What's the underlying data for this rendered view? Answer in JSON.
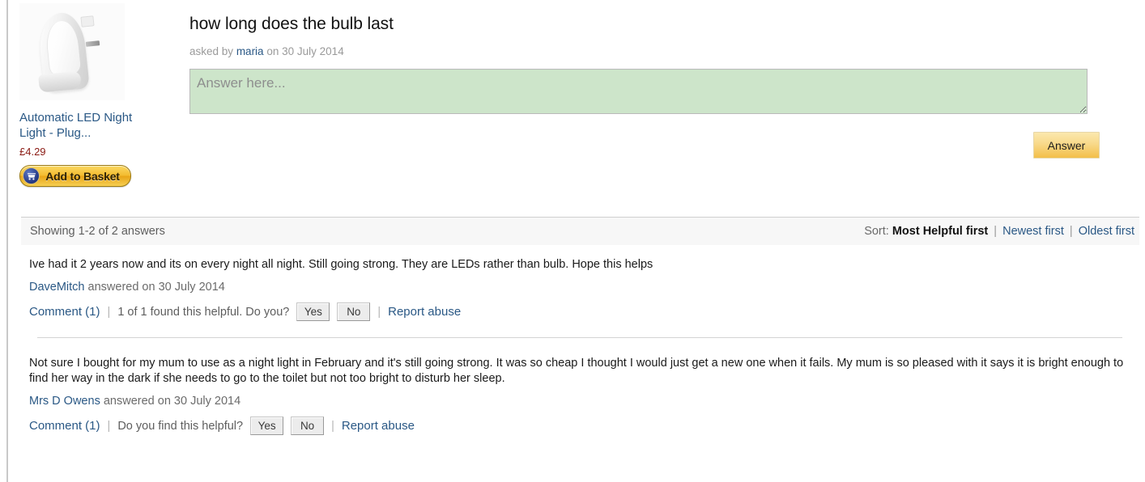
{
  "product": {
    "image_alt": "Automatic LED Night Light plug-in",
    "title": "Automatic LED Night Light - Plug...",
    "price": "£4.29",
    "add_to_basket_label": "Add to Basket"
  },
  "question": {
    "title": "how long does the bulb last",
    "asked_by_prefix": "asked by",
    "author": "maria",
    "date_prefix": "on",
    "date": "30 July 2014"
  },
  "answer_form": {
    "placeholder": "Answer here...",
    "submit_label": "Answer"
  },
  "list_header": {
    "showing": "Showing 1-2 of 2 answers",
    "sort_label": "Sort:",
    "sort_active": "Most Helpful first",
    "sort_options": [
      "Newest first",
      "Oldest first"
    ],
    "separator": "|"
  },
  "answers": [
    {
      "text": "Ive had it 2 years now and its on every night all night. Still going strong. They are LEDs rather than bulb. Hope this helps",
      "author": "DaveMitch",
      "answered_prefix": "answered on",
      "date": "30 July 2014",
      "comment_label": "Comment (1)",
      "helpful_text": "1 of 1 found this helpful. Do you?",
      "yes_label": "Yes",
      "no_label": "No",
      "report_label": "Report abuse"
    },
    {
      "text": "Not sure I bought for my mum to use as a night light in February and it's still going strong. It was so cheap I thought I would just get a new one when it fails. My mum is so pleased with it says it is bright enough to find her way in the dark if she needs to go to the toilet but not too bright to disturb her sleep.",
      "author": "Mrs D Owens",
      "answered_prefix": "answered on",
      "date": "30 July 2014",
      "comment_label": "Comment (1)",
      "helpful_text": "Do you find this helpful?",
      "yes_label": "Yes",
      "no_label": "No",
      "report_label": "Report abuse"
    }
  ],
  "colors": {
    "link": "#2a5885",
    "answer_box_bg": "#cde5ca",
    "basket_gold": "#f3bb2f",
    "answer_btn_gold": "#f8d98a",
    "price_red": "#8a1a13"
  }
}
